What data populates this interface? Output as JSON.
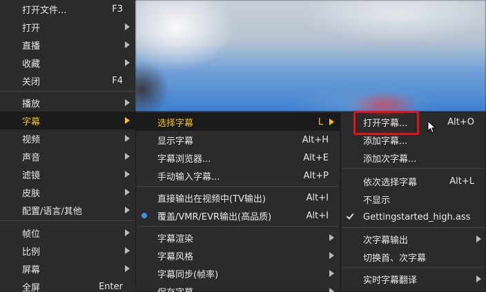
{
  "main_menu": {
    "items": [
      {
        "label": "打开文件...",
        "shortcut": "F3",
        "arrow": false
      },
      {
        "label": "打开",
        "shortcut": "",
        "arrow": true
      },
      {
        "label": "直播",
        "shortcut": "",
        "arrow": true
      },
      {
        "label": "收藏",
        "shortcut": "",
        "arrow": true
      },
      {
        "label": "关闭",
        "shortcut": "F4",
        "arrow": false
      },
      {
        "label": "播放",
        "shortcut": "",
        "arrow": true
      },
      {
        "label": "字幕",
        "shortcut": "",
        "arrow": true,
        "active": true
      },
      {
        "label": "视频",
        "shortcut": "",
        "arrow": true
      },
      {
        "label": "声音",
        "shortcut": "",
        "arrow": true
      },
      {
        "label": "滤镜",
        "shortcut": "",
        "arrow": true
      },
      {
        "label": "皮肤",
        "shortcut": "",
        "arrow": true
      },
      {
        "label": "配置/语言/其他",
        "shortcut": "",
        "arrow": true
      },
      {
        "label": "帧位",
        "shortcut": "",
        "arrow": true
      },
      {
        "label": "比例",
        "shortcut": "",
        "arrow": true
      },
      {
        "label": "屏幕",
        "shortcut": "",
        "arrow": true
      },
      {
        "label": "全屏",
        "shortcut": "Enter",
        "arrow": false
      }
    ]
  },
  "subtitle_menu": {
    "items": [
      {
        "label": "选择字幕",
        "shortcut": "L",
        "arrow": true,
        "active": true
      },
      {
        "label": "显示字幕",
        "shortcut": "Alt+H"
      },
      {
        "label": "字幕浏览器...",
        "shortcut": "Alt+E"
      },
      {
        "label": "手动输入字幕...",
        "shortcut": "Alt+P"
      },
      {
        "label": "直接输出在视频中(TV输出)",
        "shortcut": "Alt+I"
      },
      {
        "label": "覆盖/VMR/EVR输出(高品质)",
        "shortcut": "Alt+I",
        "radio": true
      },
      {
        "label": "字幕渲染",
        "shortcut": "",
        "arrow": true
      },
      {
        "label": "字幕风格",
        "shortcut": "",
        "arrow": true
      },
      {
        "label": "字幕同步(帧率)",
        "shortcut": "",
        "arrow": true
      },
      {
        "label": "保存字幕",
        "shortcut": "",
        "arrow": true
      }
    ]
  },
  "open_menu": {
    "items": [
      {
        "label": "打开字幕...",
        "shortcut": "Alt+O",
        "highlighted": true
      },
      {
        "label": "添加字幕...",
        "shortcut": ""
      },
      {
        "label": "添加次字幕...",
        "shortcut": ""
      },
      {
        "label": "依次选择字幕",
        "shortcut": "Alt+L"
      },
      {
        "label": "不显示",
        "shortcut": ""
      },
      {
        "label": "Gettingstarted_high.ass",
        "shortcut": "",
        "checked": true
      },
      {
        "label": "次字幕输出",
        "shortcut": "",
        "arrow": true
      },
      {
        "label": "切换首、次字幕",
        "shortcut": ""
      },
      {
        "label": "实时字幕翻译",
        "shortcut": "",
        "arrow": true
      }
    ]
  },
  "colors": {
    "menu_bg": "#2b2b2b",
    "active_text": "#f5c400",
    "highlight_border": "#e0141a",
    "radio_blue": "#3f8fe8"
  }
}
